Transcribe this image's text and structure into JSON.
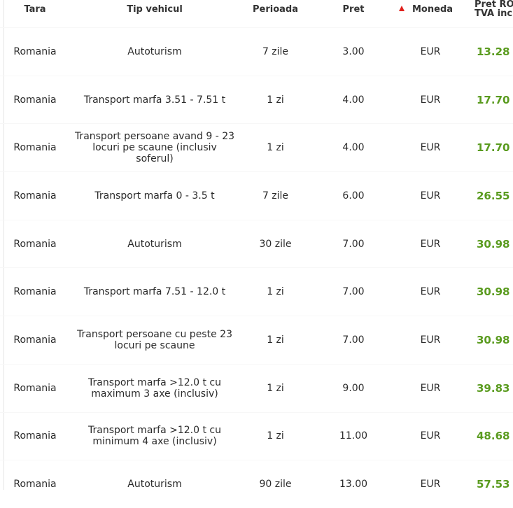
{
  "headers": {
    "tara": "Tara",
    "tip": "Tip vehicul",
    "perioada": "Perioada",
    "pret": "Pret",
    "moneda": "Moneda",
    "pret_ron_line1": "Pret RON",
    "pret_ron_line2": "TVA inclus"
  },
  "sort": {
    "column": "Moneda",
    "icon": "sort-up-arrow-icon",
    "color": "#e0201b"
  },
  "accent_color": "#5a9b1f",
  "rows": [
    {
      "tara": "Romania",
      "tip": "Autoturism",
      "perioada": "7 zile",
      "pret": "3.00",
      "moneda": "EUR",
      "pret_ron": "13.28"
    },
    {
      "tara": "Romania",
      "tip": "Transport marfa 3.51 - 7.51 t",
      "perioada": "1 zi",
      "pret": "4.00",
      "moneda": "EUR",
      "pret_ron": "17.70"
    },
    {
      "tara": "Romania",
      "tip": "Transport persoane avand 9 - 23 locuri pe scaune (inclusiv soferul)",
      "perioada": "1 zi",
      "pret": "4.00",
      "moneda": "EUR",
      "pret_ron": "17.70"
    },
    {
      "tara": "Romania",
      "tip": "Transport marfa 0 - 3.5 t",
      "perioada": "7 zile",
      "pret": "6.00",
      "moneda": "EUR",
      "pret_ron": "26.55"
    },
    {
      "tara": "Romania",
      "tip": "Autoturism",
      "perioada": "30 zile",
      "pret": "7.00",
      "moneda": "EUR",
      "pret_ron": "30.98"
    },
    {
      "tara": "Romania",
      "tip": "Transport marfa 7.51 - 12.0 t",
      "perioada": "1 zi",
      "pret": "7.00",
      "moneda": "EUR",
      "pret_ron": "30.98"
    },
    {
      "tara": "Romania",
      "tip": "Transport persoane cu peste 23 locuri pe scaune",
      "perioada": "1 zi",
      "pret": "7.00",
      "moneda": "EUR",
      "pret_ron": "30.98"
    },
    {
      "tara": "Romania",
      "tip": "Transport marfa >12.0 t cu maximum 3 axe (inclusiv)",
      "perioada": "1 zi",
      "pret": "9.00",
      "moneda": "EUR",
      "pret_ron": "39.83"
    },
    {
      "tara": "Romania",
      "tip": "Transport marfa >12.0 t cu minimum 4 axe (inclusiv)",
      "perioada": "1 zi",
      "pret": "11.00",
      "moneda": "EUR",
      "pret_ron": "48.68"
    },
    {
      "tara": "Romania",
      "tip": "Autoturism",
      "perioada": "90 zile",
      "pret": "13.00",
      "moneda": "EUR",
      "pret_ron": "57.53"
    }
  ]
}
